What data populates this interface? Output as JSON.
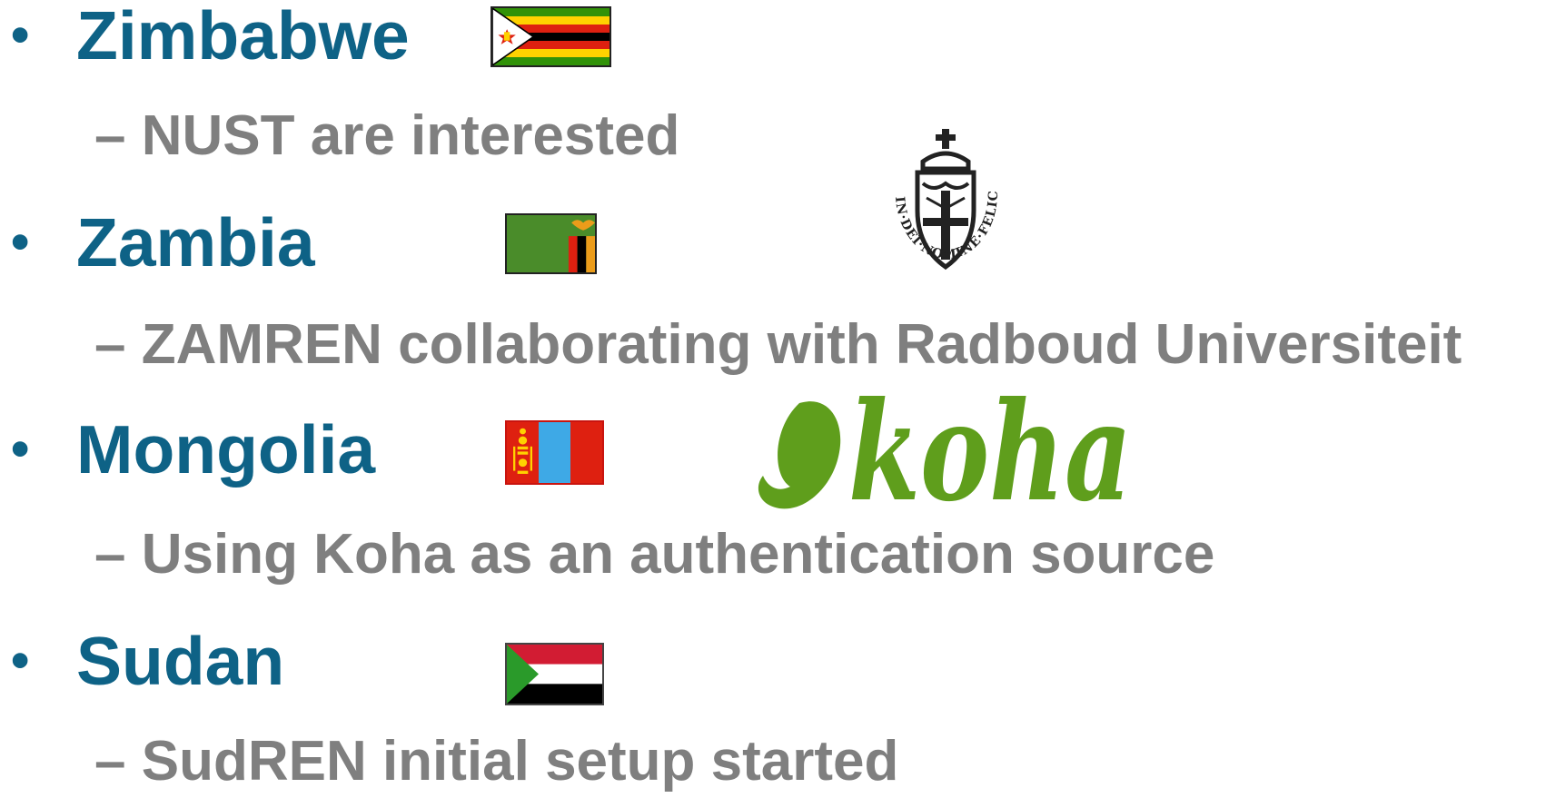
{
  "items": [
    {
      "country": "Zimbabwe",
      "detail": "NUST are interested",
      "flag_icon": "zimbabwe-flag-icon"
    },
    {
      "country": "Zambia",
      "detail": "ZAMREN collaborating with Radboud Universiteit",
      "flag_icon": "zambia-flag-icon"
    },
    {
      "country": "Mongolia",
      "detail": "Using Koha as an authentication source",
      "flag_icon": "mongolia-flag-icon"
    },
    {
      "country": "Sudan",
      "detail": "SudREN initial setup started",
      "flag_icon": "sudan-flag-icon"
    }
  ],
  "bullet": "•",
  "dash": "–",
  "radboud_seal": {
    "icon": "radboud-seal-icon",
    "motto": "IN·DEI·NOMINE·FELICITER"
  },
  "koha_logo": {
    "icon": "koha-logo-icon",
    "text": "koha"
  },
  "colors": {
    "heading": "#0e6286",
    "detail": "#7f7f7f",
    "koha_green": "#5f9e1c"
  }
}
